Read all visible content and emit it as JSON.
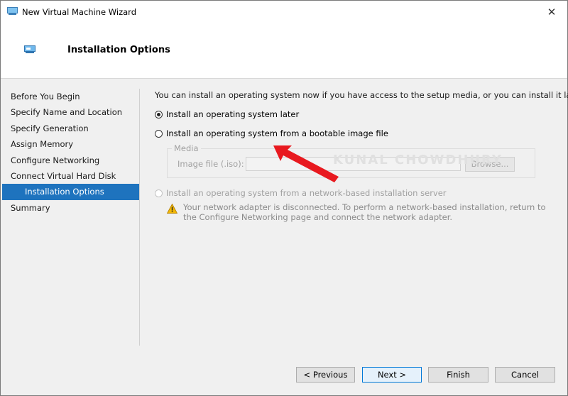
{
  "window": {
    "title": "New Virtual Machine Wizard",
    "close_glyph": "✕"
  },
  "header": {
    "title": "Installation Options"
  },
  "sidebar": {
    "items": [
      {
        "label": "Before You Begin"
      },
      {
        "label": "Specify Name and Location"
      },
      {
        "label": "Specify Generation"
      },
      {
        "label": "Assign Memory"
      },
      {
        "label": "Configure Networking"
      },
      {
        "label": "Connect Virtual Hard Disk"
      },
      {
        "label": "Installation Options",
        "active": true
      },
      {
        "label": "Summary"
      }
    ]
  },
  "content": {
    "intro": "You can install an operating system now if you have access to the setup media, or you can install it later.",
    "option_later": "Install an operating system later",
    "option_image": "Install an operating system from a bootable image file",
    "media_legend": "Media",
    "image_file_label": "Image file (.iso):",
    "image_file_value": "",
    "browse_label": "Browse...",
    "option_network": "Install an operating system from a network-based installation server",
    "warning_text": "Your network adapter is disconnected. To perform a network-based installation, return to the Configure Networking page and connect the network adapter.",
    "watermark": "KUNAL CHOWDHURY"
  },
  "footer": {
    "previous_label": "< Previous",
    "next_label": "Next >",
    "finish_label": "Finish",
    "cancel_label": "Cancel"
  },
  "colors": {
    "accent": "#1e73be",
    "annotation_arrow": "#e8191f",
    "warning": "#f2b705"
  },
  "icons": [
    "vm-app-icon",
    "close-icon",
    "vm-header-icon",
    "warning-icon",
    "annotation-arrow"
  ]
}
